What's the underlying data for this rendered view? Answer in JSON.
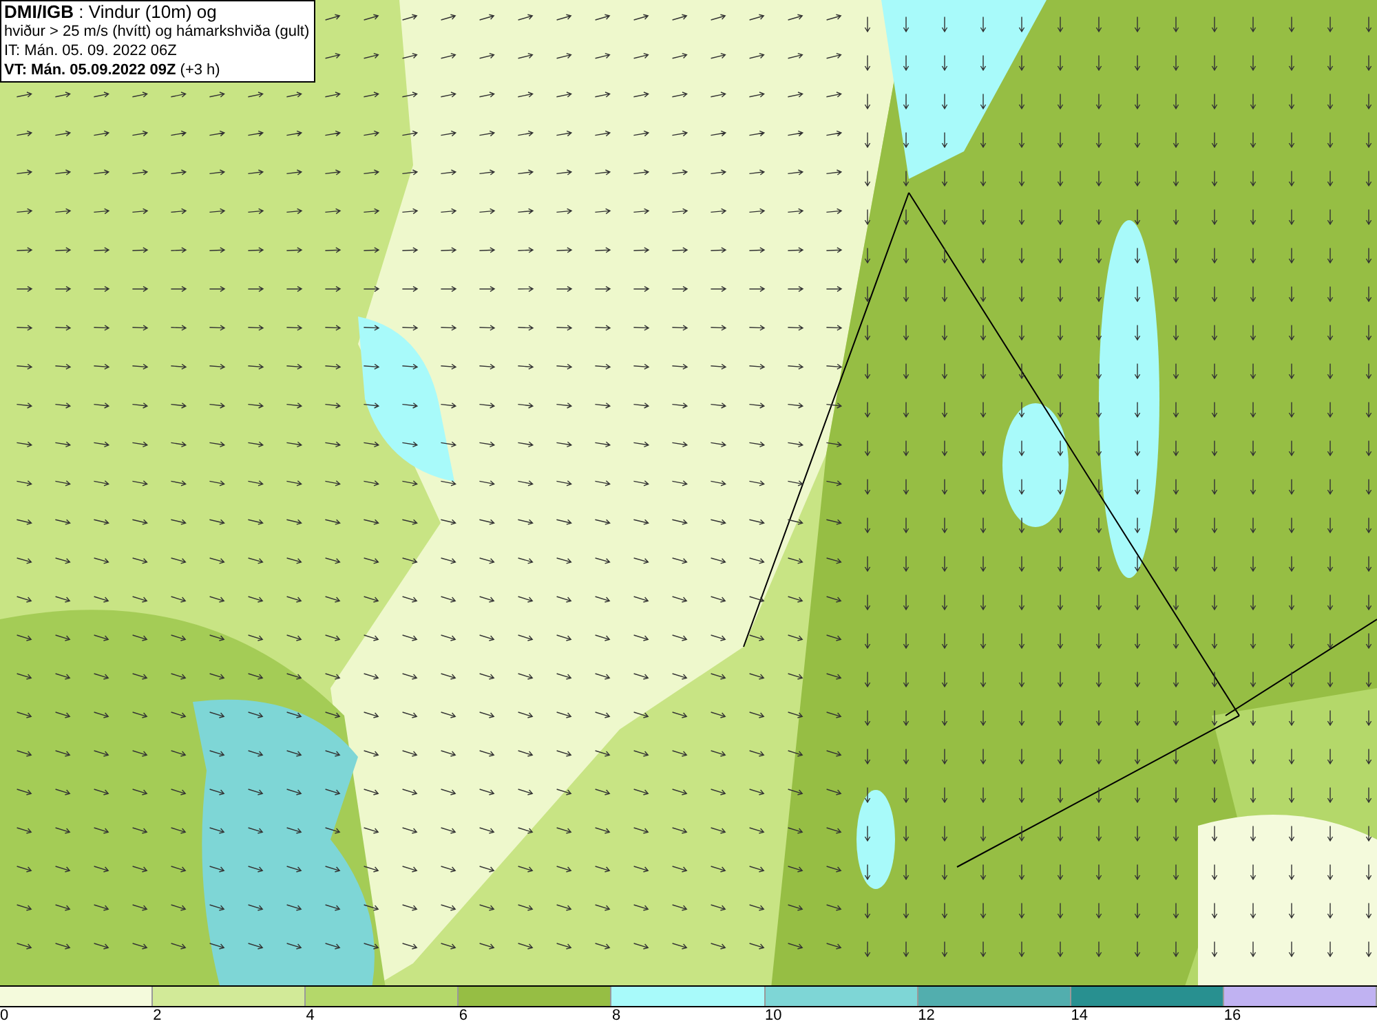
{
  "header": {
    "lines": [
      "**DMI/IGB** : Vindur (10m) og",
      "hviður > 25 m/s (hvítt) og hámarkshviða (gult)",
      "IT: Mán. 05. 09. 2022 06Z",
      "**VT: Mán. 05.09.2022 09Z** (+3 h)"
    ]
  },
  "legend": {
    "bands": [
      {
        "color": "#f4fadc"
      },
      {
        "color": "#d2ea98"
      },
      {
        "color": "#b4d86a"
      },
      {
        "color": "#96be44"
      },
      {
        "color": "#a8fafa"
      },
      {
        "color": "#7ed6d6"
      },
      {
        "color": "#52aeae"
      },
      {
        "color": "#289090"
      },
      {
        "color": "#c0b2f2"
      }
    ],
    "ticks": [
      "0",
      "2",
      "4",
      "6",
      "8",
      "10",
      "12",
      "14",
      "16"
    ]
  }
}
